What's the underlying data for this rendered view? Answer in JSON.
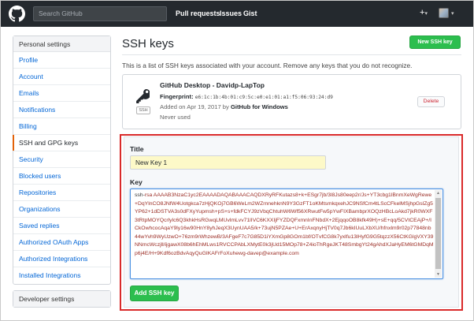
{
  "header": {
    "search_placeholder": "Search GitHub",
    "nav": [
      "Pull requests",
      "Issues",
      "Gist"
    ],
    "plus": "+",
    "caret": "▾"
  },
  "sidebar": {
    "heading": "Personal settings",
    "items": [
      {
        "label": "Profile"
      },
      {
        "label": "Account"
      },
      {
        "label": "Emails"
      },
      {
        "label": "Notifications"
      },
      {
        "label": "Billing"
      },
      {
        "label": "SSH and GPG keys",
        "active": true
      },
      {
        "label": "Security"
      },
      {
        "label": "Blocked users"
      },
      {
        "label": "Repositories"
      },
      {
        "label": "Organizations"
      },
      {
        "label": "Saved replies"
      },
      {
        "label": "Authorized OAuth Apps"
      },
      {
        "label": "Authorized Integrations"
      },
      {
        "label": "Installed Integrations"
      }
    ],
    "developer_heading": "Developer settings"
  },
  "main": {
    "title": "SSH keys",
    "new_button": "New SSH key",
    "intro": "This is a list of SSH keys associated with your account. Remove any keys that you do not recognize.",
    "key": {
      "badge": "SSH",
      "name": "GitHub Desktop - Davidp-LapTop",
      "fingerprint_label": "Fingerprint:",
      "fingerprint": "e6:1c:1b:4b:01:c9:5c:e0:e1:01:a1:f5:06:93:24:d9",
      "added_prefix": "Added on Apr 19, 2017 by",
      "added_by": "GitHub for Windows",
      "usage": "Never used",
      "delete_label": "Delete"
    },
    "form": {
      "title_label": "Title",
      "title_value": "New Key 1",
      "key_label": "Key",
      "key_prefix": "ssh-",
      "key_value": "rsa AAAAB3NzaC1yc2EAAAADAQABAAACAQDXRyRFKutazs8+k+ESgr7jb/3l8Js80eep2r/Js+YT3cbg1lBnmXeWgRewe+DqYlnCO8JNfW4Uotgkca7zHjQKOj7GB6WeLm2WZrnnehknN9Y3GzFT1oKMtsmkqxehJC9NSfCm4tLScCFkelMSjhpGslZg5YP62+1dDSTVA3s0dFXyYupmsh+pS+s+fdkFCYJ9zVbqChtuhW6Wf56XRwutFw5pYwFIXBambprXOQzHBcLoAkd7jkR0WXF3tRtpMOYQcrlylc6Q3khkHsRGwqLMUvlmLvv71lIVC6KXXIjFYZDQFxmnInFNbdX+2EjqqoOB8kfk49H)+sE+qq/5CVtCEAjP+/ICkOwhcocAqaY9ly16w90HnY8yhJeqX3UynUAA5/k+73ujN5PZAe+U+ErAxqnyHjTV0q7Jb6kIUuLXbXU/hfnxlm9r02p77848nb44wYvh9WyUzwO+76zm9rWhzewB/3AFgeF7c7G85D1iYXmGp8GOm1bf/OTvfCG8k7yxlfu13lHyfG9G5tqzzX56CtKGlgVXY39NNmcWczjll/ijgawX08b6hEhMLws1RVCCPAbLXMytE0k3jUd15MOp78+Z4ioThRgeJKT48SmbgYt24gAhdXJaHyEM6tGMDqMp6j4E/H+9Kdf6ozBdvAqyQuGIKAFrFoXuhewg-davep@example.com"
    },
    "add_button": "Add SSH key"
  }
}
